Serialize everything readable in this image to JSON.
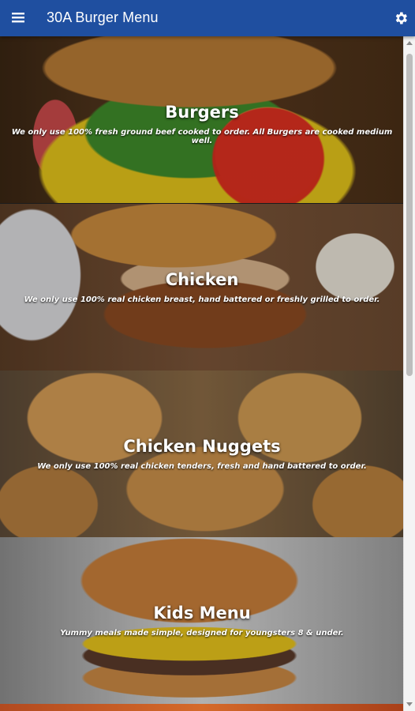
{
  "appbar": {
    "title": "30A Burger Menu",
    "menu_icon": "hamburger-menu-icon",
    "settings_icon": "gear-icon",
    "color": "#1f4fa0"
  },
  "menu": {
    "categories": [
      {
        "title": "Burgers",
        "description": "We only use 100% fresh ground beef cooked to order. All Burgers are cooked medium well."
      },
      {
        "title": "Chicken",
        "description": "We only use 100% real chicken breast, hand battered or freshly grilled to order."
      },
      {
        "title": "Chicken Nuggets",
        "description": "We only use 100% real chicken tenders, fresh and hand battered to order."
      },
      {
        "title": "Kids Menu",
        "description": "Yummy meals made simple, designed for youngsters 8 & under."
      }
    ]
  }
}
